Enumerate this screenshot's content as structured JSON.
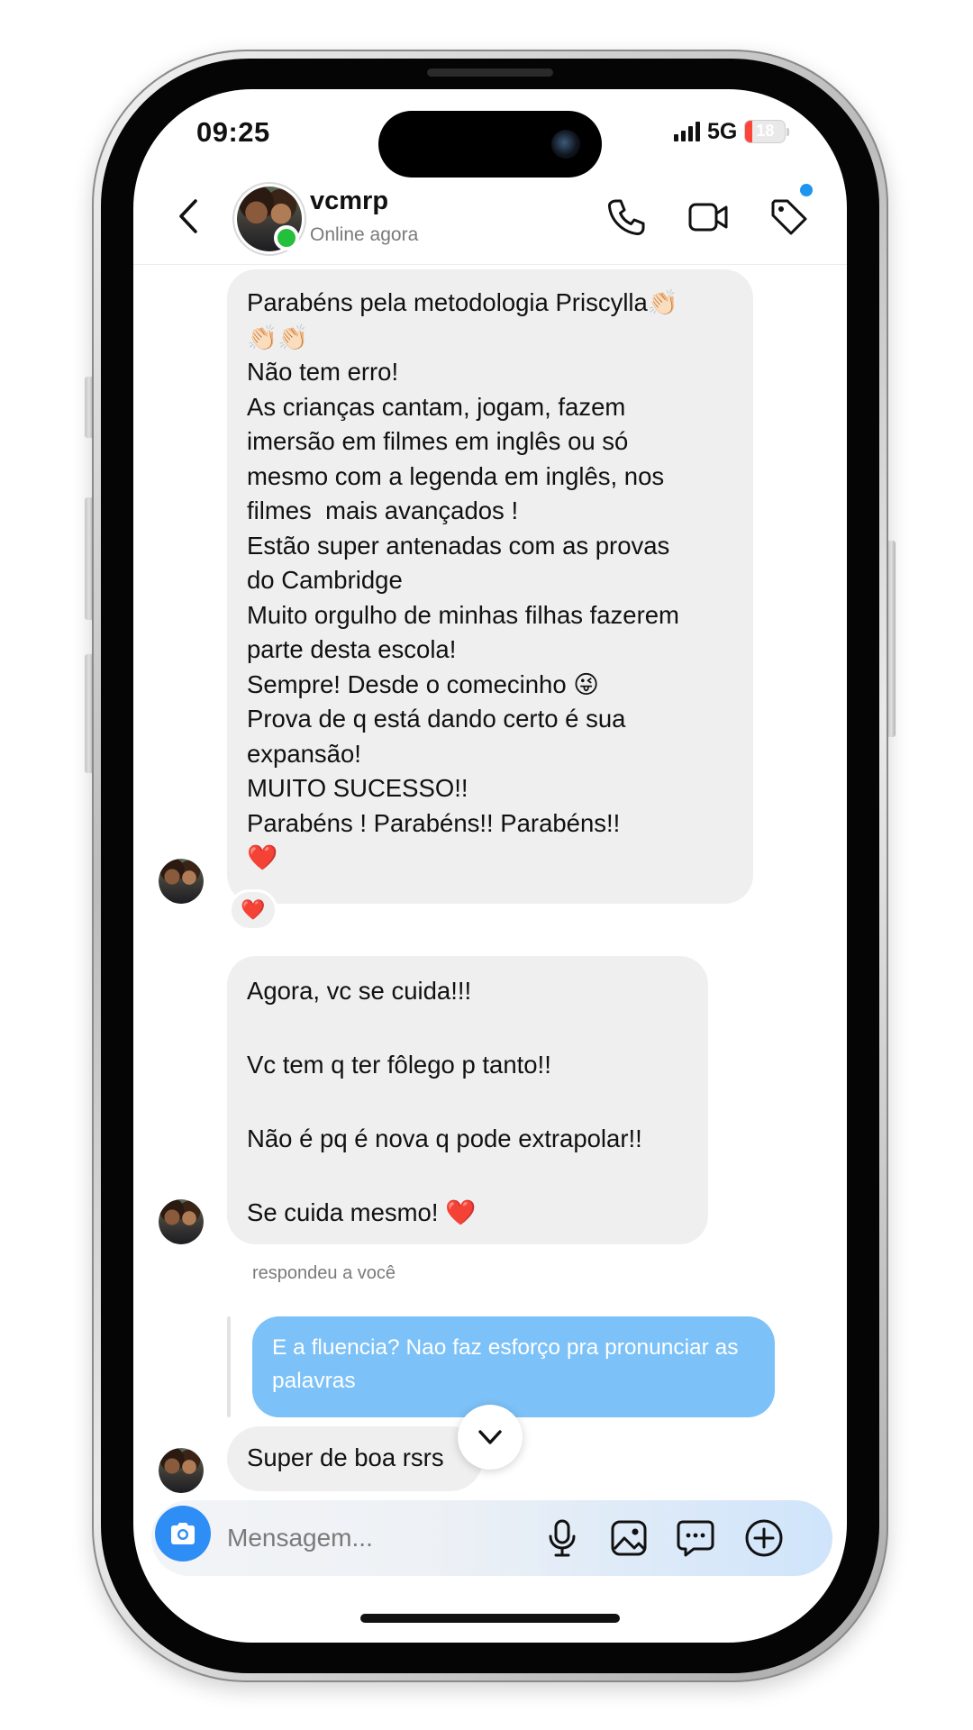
{
  "status_bar": {
    "time": "09:25",
    "network": "5G",
    "battery_level": "18",
    "battery_fraction": 0.18,
    "signal_icon": "signal-bars-icon"
  },
  "chat_header": {
    "contact_name": "vcmrp",
    "status": "Online agora",
    "icons": [
      "back-chevron-icon",
      "phone-icon",
      "video-icon",
      "tag-icon"
    ],
    "online_color": "#24c03b",
    "notification_dot_color": "#1e96f0"
  },
  "messages": [
    {
      "text": "Parabéns pela metodologia Priscylla👏🏻\n👏🏻👏🏻\nNão tem erro!\nAs crianças cantam, jogam, fazem\nimersão em filmes em inglês ou só\nmesmo com a legenda em inglês, nos\nfilmes  mais avançados !\nEstão super antenadas com as provas\ndo Cambridge\nMuito orgulho de minhas filhas fazerem\nparte desta escola!\nSempre! Desde o comecinho 😜\nProva de q está dando certo é sua\nexpansão!\nMUITO SUCESSO!!\nParabéns ! Parabéns!! Parabéns!!\n❤️",
      "reaction": "❤️"
    },
    {
      "text": "Agora, vc se cuida!!!\n\nVc tem q ter fôlego p tanto!!\n\nNão é pq é nova q pode extrapolar!!\n\nSe cuida mesmo! ❤️"
    },
    {
      "reply_label": "respondeu a você",
      "quoted_text": "E a fluencia? Nao faz esforço pra pronunciar as palavras",
      "text": "Super de boa rsrs"
    }
  ],
  "composer": {
    "placeholder": "Mensagem...",
    "icons": [
      "camera-icon",
      "microphone-icon",
      "image-icon",
      "sticker-icon",
      "add-icon"
    ],
    "camera_button_color": "#2f8ef5",
    "quoted_bubble_color": "#7cc1f7"
  }
}
